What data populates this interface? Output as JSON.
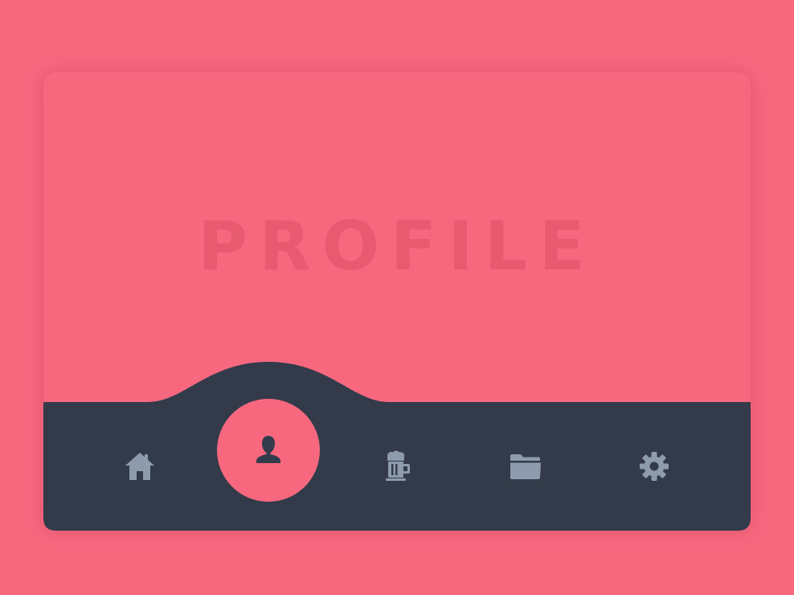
{
  "page": {
    "title": "PROFILE"
  },
  "colors": {
    "background": "#F7687F",
    "navbar": "#333B4A",
    "icon": "#8D9BAD",
    "active_bubble": "#F7687F",
    "active_icon": "#333B4A"
  },
  "navbar": {
    "active_index": 1,
    "items": [
      {
        "id": "home",
        "icon": "home-icon",
        "active": false
      },
      {
        "id": "profile",
        "icon": "user-icon",
        "active": true
      },
      {
        "id": "drinks",
        "icon": "beer-mug-icon",
        "active": false
      },
      {
        "id": "files",
        "icon": "folder-icon",
        "active": false
      },
      {
        "id": "settings",
        "icon": "gear-icon",
        "active": false
      }
    ]
  }
}
